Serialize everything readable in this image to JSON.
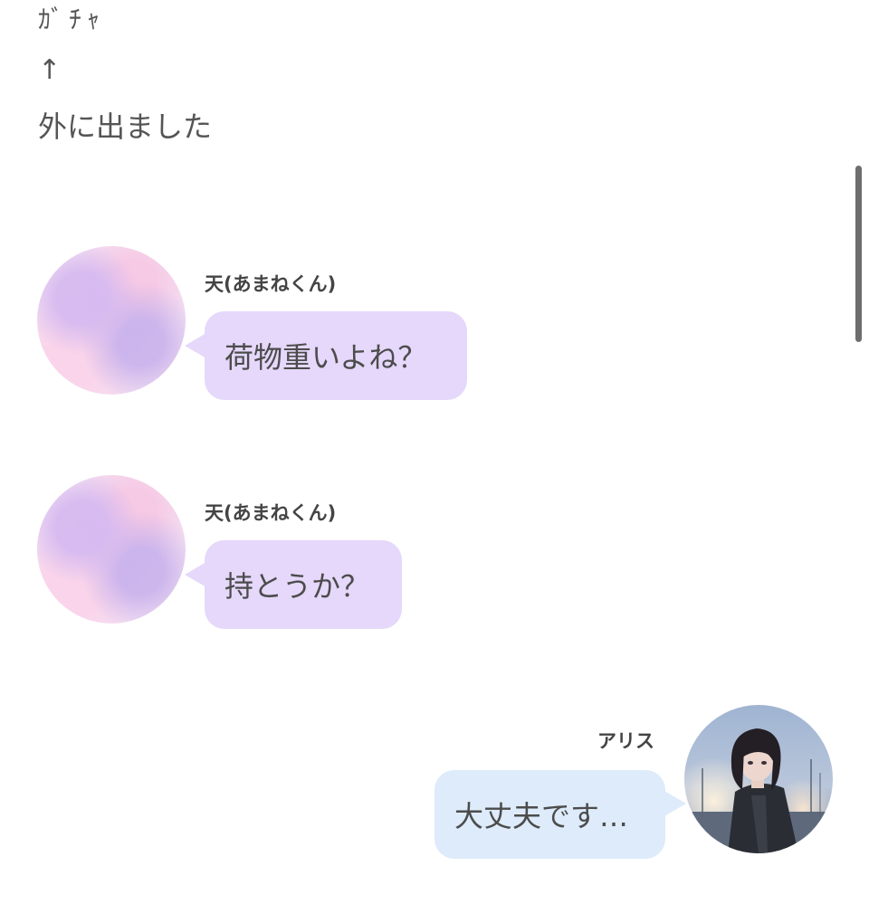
{
  "narration": [
    {
      "text": "ｶﾞﾁｬ"
    },
    {
      "text": "↑"
    },
    {
      "text": "外に出ました"
    }
  ],
  "messages": [
    {
      "speaker": "天(あまねくん)",
      "text": "荷物重いよね？",
      "side": "left",
      "avatar": "pastel-avatar"
    },
    {
      "speaker": "天(あまねくん)",
      "text": "持とうか？",
      "side": "left",
      "avatar": "pastel-avatar"
    },
    {
      "speaker": "アリス",
      "text": "大丈夫です…",
      "side": "right",
      "avatar": "girl-avatar"
    }
  ],
  "colors": {
    "bubble_left": "#e5d8fa",
    "bubble_right": "#ddebfa",
    "text": "#4c4c4c",
    "scrollbar": "#6e6e6e"
  }
}
